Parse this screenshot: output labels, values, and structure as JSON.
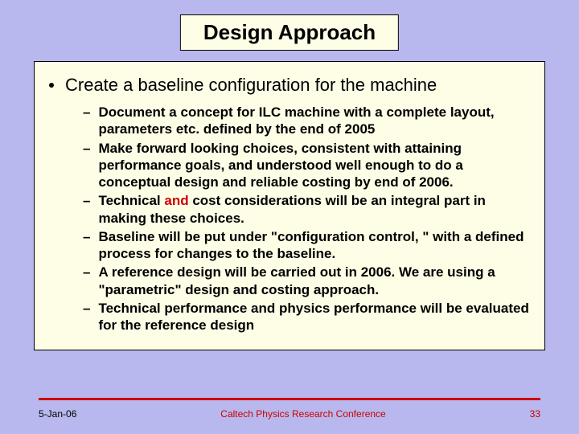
{
  "title": "Design Approach",
  "main_bullet": "Create a baseline configuration for the machine",
  "sub_bullets": [
    {
      "pre": "Document a concept for ILC machine with a complete layout, parameters etc. defined by the end of 2005",
      "red": "",
      "post": ""
    },
    {
      "pre": "Make forward looking choices, consistent with attaining performance goals, and understood well enough to do a conceptual design and reliable costing by end of 2006.",
      "red": "",
      "post": ""
    },
    {
      "pre": "Technical ",
      "red": "and",
      "post": " cost considerations will be an integral part in making these choices."
    },
    {
      "pre": "Baseline will be put under \"configuration control, \" with a defined process for changes to the baseline.",
      "red": "",
      "post": ""
    },
    {
      "pre": "A reference design will be carried out in 2006.   We are using a \"parametric\" design and costing approach.",
      "red": "",
      "post": ""
    },
    {
      "pre": "Technical performance and physics performance will be evaluated for the reference design",
      "red": "",
      "post": ""
    }
  ],
  "footer": {
    "date": "5-Jan-06",
    "center": "Caltech Physics Research Conference",
    "page": "33"
  }
}
